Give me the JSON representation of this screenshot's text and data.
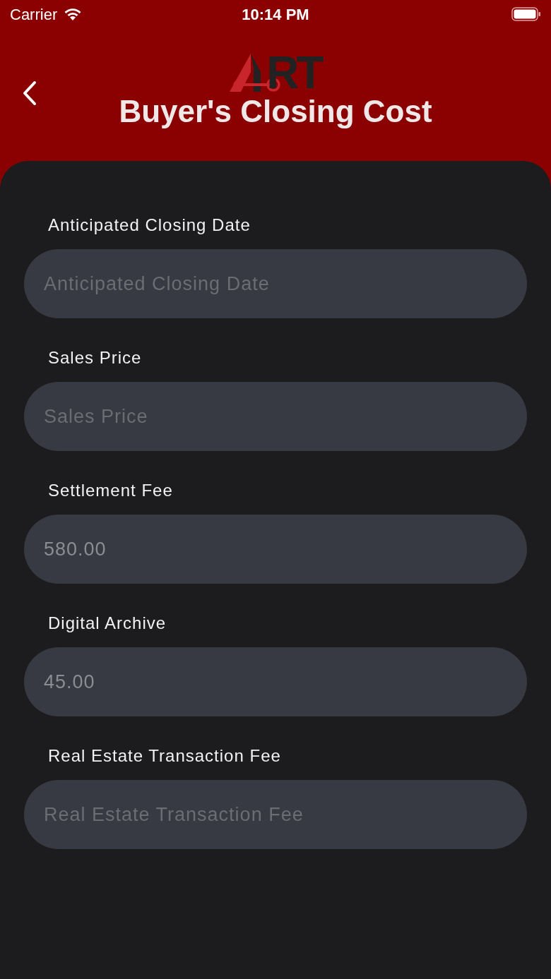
{
  "status_bar": {
    "carrier": "Carrier",
    "time": "10:14 PM"
  },
  "header": {
    "logo_text": "RT",
    "title": "Buyer's Closing Cost"
  },
  "fields": [
    {
      "label": "Anticipated Closing Date",
      "placeholder": "Anticipated Closing Date"
    },
    {
      "label": "Sales Price",
      "placeholder": "Sales Price"
    },
    {
      "label": "Settlement Fee",
      "value": "580.00"
    },
    {
      "label": "Digital Archive",
      "value": "45.00"
    },
    {
      "label": "Real Estate Transaction Fee",
      "placeholder": "Real Estate Transaction Fee"
    }
  ]
}
